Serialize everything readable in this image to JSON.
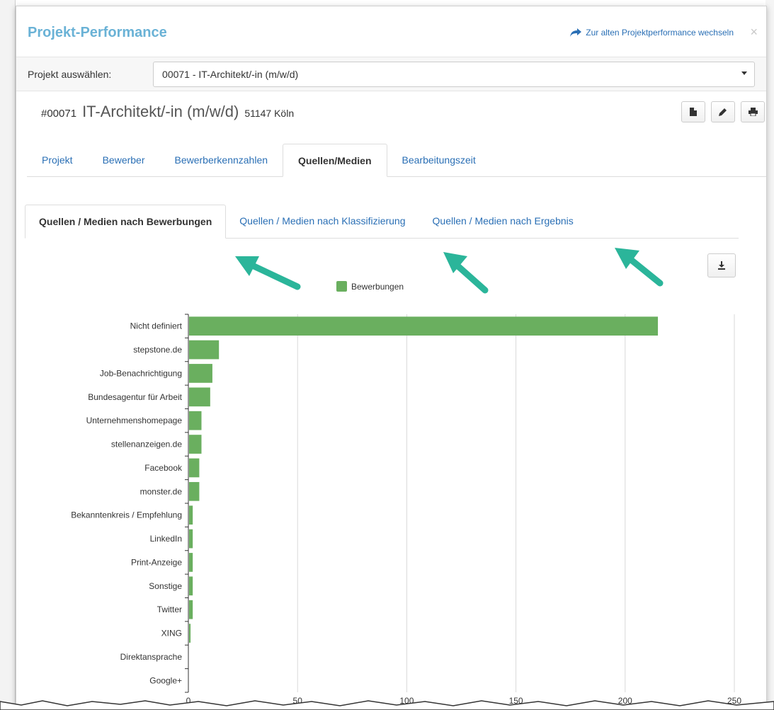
{
  "modal": {
    "title": "Projekt-Performance",
    "switch_link": "Zur alten Projektperformance wechseln",
    "close": "×"
  },
  "project_select": {
    "label": "Projekt auswählen:",
    "value": "00071 - IT-Architekt/-in (m/w/d)"
  },
  "project": {
    "id": "#00071",
    "title": "IT-Architekt/-in (m/w/d)",
    "location": "51147 Köln"
  },
  "tools": {
    "icons": [
      "document-icon",
      "pencil-icon",
      "print-icon"
    ]
  },
  "main_tabs": [
    {
      "label": "Projekt",
      "active": false
    },
    {
      "label": "Bewerber",
      "active": false
    },
    {
      "label": "Bewerberkennzahlen",
      "active": false
    },
    {
      "label": "Quellen/Medien",
      "active": true
    },
    {
      "label": "Bearbeitungszeit",
      "active": false
    }
  ],
  "sub_tabs": [
    {
      "label": "Quellen / Medien nach Bewerbungen",
      "active": true
    },
    {
      "label": "Quellen / Medien nach Klassifizierung",
      "active": false
    },
    {
      "label": "Quellen / Medien nach Ergebnis",
      "active": false
    }
  ],
  "colors": {
    "bar": "#6aaf5f",
    "arrow": "#2bb59a",
    "title": "#6ab2d6",
    "link": "#2a6fb5"
  },
  "chart_data": {
    "type": "bar",
    "orientation": "horizontal",
    "legend": "Bewerbungen",
    "categories": [
      "Nicht definiert",
      "stepstone.de",
      "Job-Benachrichtigung",
      "Bundesagentur für Arbeit",
      "Unternehmenshomepage",
      "stellenanzeigen.de",
      "Facebook",
      "monster.de",
      "Bekanntenkreis / Empfehlung",
      "LinkedIn",
      "Print-Anzeige",
      "Sonstige",
      "Twitter",
      "XING",
      "Direktansprache",
      "Google+"
    ],
    "series": [
      {
        "name": "Bewerbungen",
        "values": [
          215,
          14,
          11,
          10,
          6,
          6,
          5,
          5,
          2,
          2,
          2,
          2,
          2,
          1,
          0,
          0
        ]
      }
    ],
    "xlim": [
      0,
      250
    ],
    "xticks": [
      0,
      50,
      100,
      150,
      200,
      250
    ],
    "grid": true,
    "legend_position": "top-center"
  }
}
